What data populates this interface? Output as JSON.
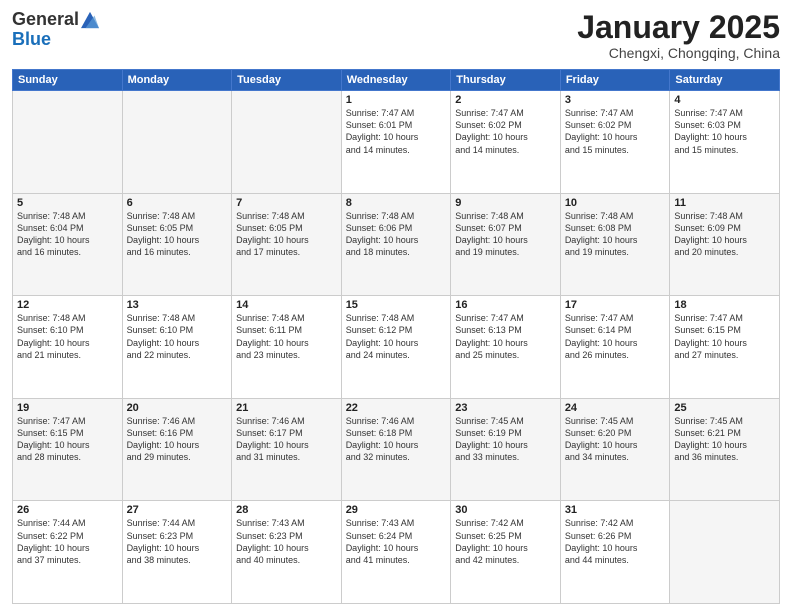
{
  "header": {
    "logo_line1": "General",
    "logo_line2": "Blue",
    "month": "January 2025",
    "location": "Chengxi, Chongqing, China"
  },
  "weekdays": [
    "Sunday",
    "Monday",
    "Tuesday",
    "Wednesday",
    "Thursday",
    "Friday",
    "Saturday"
  ],
  "weeks": [
    [
      {
        "day": "",
        "info": ""
      },
      {
        "day": "",
        "info": ""
      },
      {
        "day": "",
        "info": ""
      },
      {
        "day": "1",
        "info": "Sunrise: 7:47 AM\nSunset: 6:01 PM\nDaylight: 10 hours\nand 14 minutes."
      },
      {
        "day": "2",
        "info": "Sunrise: 7:47 AM\nSunset: 6:02 PM\nDaylight: 10 hours\nand 14 minutes."
      },
      {
        "day": "3",
        "info": "Sunrise: 7:47 AM\nSunset: 6:02 PM\nDaylight: 10 hours\nand 15 minutes."
      },
      {
        "day": "4",
        "info": "Sunrise: 7:47 AM\nSunset: 6:03 PM\nDaylight: 10 hours\nand 15 minutes."
      }
    ],
    [
      {
        "day": "5",
        "info": "Sunrise: 7:48 AM\nSunset: 6:04 PM\nDaylight: 10 hours\nand 16 minutes."
      },
      {
        "day": "6",
        "info": "Sunrise: 7:48 AM\nSunset: 6:05 PM\nDaylight: 10 hours\nand 16 minutes."
      },
      {
        "day": "7",
        "info": "Sunrise: 7:48 AM\nSunset: 6:05 PM\nDaylight: 10 hours\nand 17 minutes."
      },
      {
        "day": "8",
        "info": "Sunrise: 7:48 AM\nSunset: 6:06 PM\nDaylight: 10 hours\nand 18 minutes."
      },
      {
        "day": "9",
        "info": "Sunrise: 7:48 AM\nSunset: 6:07 PM\nDaylight: 10 hours\nand 19 minutes."
      },
      {
        "day": "10",
        "info": "Sunrise: 7:48 AM\nSunset: 6:08 PM\nDaylight: 10 hours\nand 19 minutes."
      },
      {
        "day": "11",
        "info": "Sunrise: 7:48 AM\nSunset: 6:09 PM\nDaylight: 10 hours\nand 20 minutes."
      }
    ],
    [
      {
        "day": "12",
        "info": "Sunrise: 7:48 AM\nSunset: 6:10 PM\nDaylight: 10 hours\nand 21 minutes."
      },
      {
        "day": "13",
        "info": "Sunrise: 7:48 AM\nSunset: 6:10 PM\nDaylight: 10 hours\nand 22 minutes."
      },
      {
        "day": "14",
        "info": "Sunrise: 7:48 AM\nSunset: 6:11 PM\nDaylight: 10 hours\nand 23 minutes."
      },
      {
        "day": "15",
        "info": "Sunrise: 7:48 AM\nSunset: 6:12 PM\nDaylight: 10 hours\nand 24 minutes."
      },
      {
        "day": "16",
        "info": "Sunrise: 7:47 AM\nSunset: 6:13 PM\nDaylight: 10 hours\nand 25 minutes."
      },
      {
        "day": "17",
        "info": "Sunrise: 7:47 AM\nSunset: 6:14 PM\nDaylight: 10 hours\nand 26 minutes."
      },
      {
        "day": "18",
        "info": "Sunrise: 7:47 AM\nSunset: 6:15 PM\nDaylight: 10 hours\nand 27 minutes."
      }
    ],
    [
      {
        "day": "19",
        "info": "Sunrise: 7:47 AM\nSunset: 6:15 PM\nDaylight: 10 hours\nand 28 minutes."
      },
      {
        "day": "20",
        "info": "Sunrise: 7:46 AM\nSunset: 6:16 PM\nDaylight: 10 hours\nand 29 minutes."
      },
      {
        "day": "21",
        "info": "Sunrise: 7:46 AM\nSunset: 6:17 PM\nDaylight: 10 hours\nand 31 minutes."
      },
      {
        "day": "22",
        "info": "Sunrise: 7:46 AM\nSunset: 6:18 PM\nDaylight: 10 hours\nand 32 minutes."
      },
      {
        "day": "23",
        "info": "Sunrise: 7:45 AM\nSunset: 6:19 PM\nDaylight: 10 hours\nand 33 minutes."
      },
      {
        "day": "24",
        "info": "Sunrise: 7:45 AM\nSunset: 6:20 PM\nDaylight: 10 hours\nand 34 minutes."
      },
      {
        "day": "25",
        "info": "Sunrise: 7:45 AM\nSunset: 6:21 PM\nDaylight: 10 hours\nand 36 minutes."
      }
    ],
    [
      {
        "day": "26",
        "info": "Sunrise: 7:44 AM\nSunset: 6:22 PM\nDaylight: 10 hours\nand 37 minutes."
      },
      {
        "day": "27",
        "info": "Sunrise: 7:44 AM\nSunset: 6:23 PM\nDaylight: 10 hours\nand 38 minutes."
      },
      {
        "day": "28",
        "info": "Sunrise: 7:43 AM\nSunset: 6:23 PM\nDaylight: 10 hours\nand 40 minutes."
      },
      {
        "day": "29",
        "info": "Sunrise: 7:43 AM\nSunset: 6:24 PM\nDaylight: 10 hours\nand 41 minutes."
      },
      {
        "day": "30",
        "info": "Sunrise: 7:42 AM\nSunset: 6:25 PM\nDaylight: 10 hours\nand 42 minutes."
      },
      {
        "day": "31",
        "info": "Sunrise: 7:42 AM\nSunset: 6:26 PM\nDaylight: 10 hours\nand 44 minutes."
      },
      {
        "day": "",
        "info": ""
      }
    ]
  ]
}
